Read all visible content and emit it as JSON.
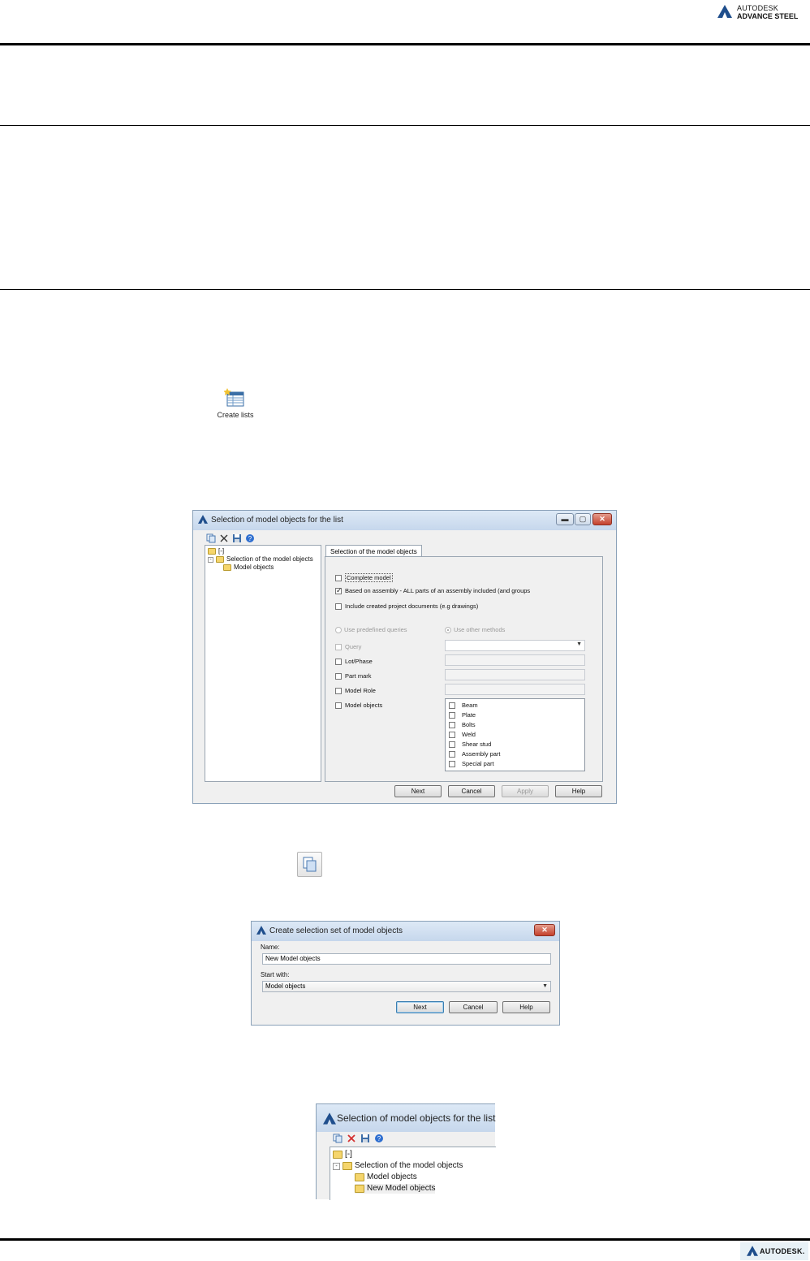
{
  "header": {
    "brand_line1": "AUTODESK",
    "brand_line2": "ADVANCE STEEL"
  },
  "create_lists": {
    "label": "Create lists"
  },
  "dialog1": {
    "title": "Selection of model objects for the list",
    "tree": {
      "root": "[-]",
      "node": "Selection of the model objects",
      "child": "Model objects"
    },
    "tab": "Selection of the model objects",
    "options": {
      "complete_model": "Complete model",
      "based_on_assembly": "Based on assembly  -  ALL parts of an assembly included (and groups",
      "include_docs": "Include created project documents (e.g drawings)"
    },
    "radios": {
      "predefined": "Use predefined queries",
      "other": "Use other methods"
    },
    "filters": {
      "query": "Query",
      "lot_phase": "Lot/Phase",
      "part_mark": "Part mark",
      "model_role": "Model Role",
      "model_objects": "Model objects"
    },
    "object_types": [
      "Beam",
      "Plate",
      "Bolts",
      "Weld",
      "Shear stud",
      "Assembly part",
      "Special part"
    ],
    "buttons": {
      "next": "Next",
      "cancel": "Cancel",
      "apply": "Apply",
      "help": "Help"
    }
  },
  "dialog2": {
    "title": "Create selection set of model objects",
    "name_label": "Name:",
    "name_value": "New Model objects",
    "start_label": "Start with:",
    "start_value": "Model objects",
    "buttons": {
      "next": "Next",
      "cancel": "Cancel",
      "help": "Help"
    }
  },
  "dialog3": {
    "title": "Selection of model objects for the list",
    "tree": {
      "root": "[-]",
      "node": "Selection of the model objects",
      "child1": "Model objects",
      "child2": "New Model objects"
    }
  },
  "footer": {
    "brand": "AUTODESK."
  }
}
